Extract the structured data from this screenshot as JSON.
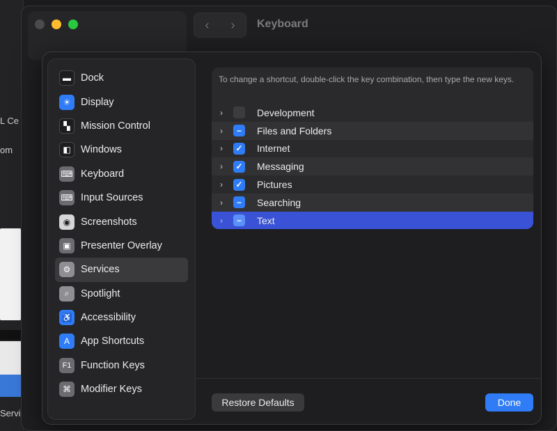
{
  "background": {
    "fragments": [
      "L Ce",
      "om",
      "Servi"
    ]
  },
  "window": {
    "title": "Keyboard",
    "nav": {
      "back_icon": "‹",
      "forward_icon": "›"
    }
  },
  "sidebar": {
    "items": [
      {
        "label": "Dock",
        "icon": "▬"
      },
      {
        "label": "Display",
        "icon": "☀"
      },
      {
        "label": "Mission Control",
        "icon": "▚"
      },
      {
        "label": "Windows",
        "icon": "◧"
      },
      {
        "label": "Keyboard",
        "icon": "⌨"
      },
      {
        "label": "Input Sources",
        "icon": "⌨"
      },
      {
        "label": "Screenshots",
        "icon": "◉"
      },
      {
        "label": "Presenter Overlay",
        "icon": "▣"
      },
      {
        "label": "Services",
        "icon": "⚙"
      },
      {
        "label": "Spotlight",
        "icon": "⌕"
      },
      {
        "label": "Accessibility",
        "icon": "♿"
      },
      {
        "label": "App Shortcuts",
        "icon": "A"
      },
      {
        "label": "Function Keys",
        "icon": "F1"
      },
      {
        "label": "Modifier Keys",
        "icon": "⌘"
      }
    ],
    "selected": "Services"
  },
  "panel": {
    "description": "To change a shortcut, double-click the key combination, then type the new keys.",
    "rows": [
      {
        "label": "Development",
        "state": "off",
        "mark": ""
      },
      {
        "label": "Files and Folders",
        "state": "mixed",
        "mark": "−"
      },
      {
        "label": "Internet",
        "state": "on",
        "mark": "✓"
      },
      {
        "label": "Messaging",
        "state": "on",
        "mark": "✓"
      },
      {
        "label": "Pictures",
        "state": "on",
        "mark": "✓"
      },
      {
        "label": "Searching",
        "state": "mixed",
        "mark": "−"
      },
      {
        "label": "Text",
        "state": "mixed",
        "mark": "−"
      }
    ],
    "chevron": "›",
    "selected_row": "Text"
  },
  "footer": {
    "restore_label": "Restore Defaults",
    "done_label": "Done"
  },
  "colors": {
    "accent": "#2f7cf6",
    "selection": "#3952d6"
  }
}
